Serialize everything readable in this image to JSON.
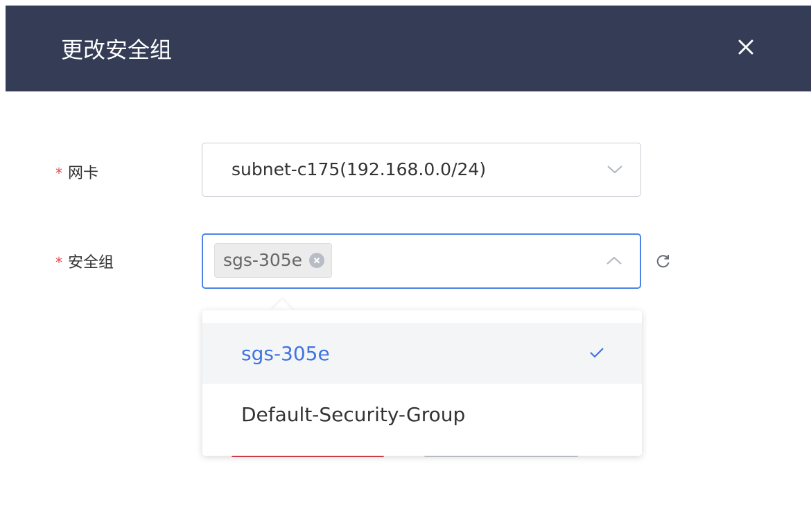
{
  "dialog": {
    "title": "更改安全组"
  },
  "form": {
    "nic": {
      "required_mark": "*",
      "label": "网卡",
      "value": "subnet-c175(192.168.0.0/24)"
    },
    "security_group": {
      "required_mark": "*",
      "label": "安全组",
      "selected_tag": "sgs-305e"
    }
  },
  "dropdown": {
    "options": [
      {
        "label": "sgs-305e",
        "selected": true
      },
      {
        "label": "Default-Security-Group",
        "selected": false
      }
    ]
  },
  "colors": {
    "header_bg": "#343d55",
    "accent": "#3f73e0",
    "required": "#e5484d",
    "focus_border": "#4b84e6"
  },
  "icons": {
    "close": "close-icon",
    "chevron_down": "chevron-down-icon",
    "chevron_up": "chevron-up-icon",
    "refresh": "refresh-icon",
    "check": "check-icon",
    "tag_remove": "tag-remove-icon"
  }
}
